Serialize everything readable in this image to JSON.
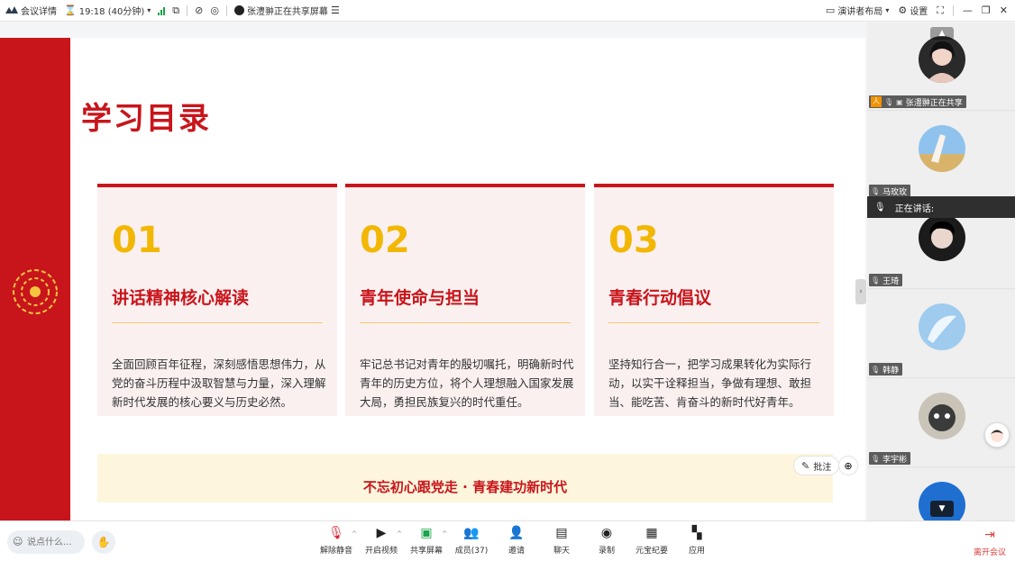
{
  "topbar": {
    "meeting_details": "会议详情",
    "time_text": "19:18 (40分钟)",
    "sharing_text": "张澧翀正在共享屏幕",
    "presenter_layout": "演讲者布局",
    "settings": "设置"
  },
  "slide": {
    "title": "学习目录",
    "cards": [
      {
        "num": "01",
        "heading": "讲话精神核心解读",
        "body": "全面回顾百年征程，深刻感悟思想伟力，从党的奋斗历程中汲取智慧与力量，深入理解新时代发展的核心要义与历史必然。"
      },
      {
        "num": "02",
        "heading": "青年使命与担当",
        "body": "牢记总书记对青年的殷切嘱托，明确新时代青年的历史方位，将个人理想融入国家发展大局，勇担民族复兴的时代重任。"
      },
      {
        "num": "03",
        "heading": "青春行动倡议",
        "body": "坚持知行合一，把学习成果转化为实际行动，以实干诠释担当，争做有理想、敢担当、能吃苦、肯奋斗的新时代好青年。"
      }
    ],
    "banner": "不忘初心跟党走 · 青春建功新时代",
    "annotate": "批注"
  },
  "participants": {
    "speaking_label": "正在讲话:",
    "list": [
      {
        "name": "张澧翀正在共享"
      },
      {
        "name": "马玫玫"
      },
      {
        "name": "王琦"
      },
      {
        "name": "韩静"
      },
      {
        "name": "李宇彬"
      }
    ]
  },
  "bottombar": {
    "say_placeholder": "说点什么...",
    "tools": [
      {
        "label": "解除静音",
        "icon": "mic-muted-icon"
      },
      {
        "label": "开启视频",
        "icon": "video-off-icon"
      },
      {
        "label": "共享屏幕",
        "icon": "share-screen-icon"
      },
      {
        "label": "成员(37)",
        "icon": "members-icon"
      },
      {
        "label": "邀请",
        "icon": "invite-icon"
      },
      {
        "label": "聊天",
        "icon": "chat-icon"
      },
      {
        "label": "录制",
        "icon": "record-icon"
      },
      {
        "label": "元宝纪要",
        "icon": "summary-icon"
      },
      {
        "label": "应用",
        "icon": "apps-icon"
      }
    ],
    "leave": "离开会议"
  },
  "colors": {
    "accent_red": "#c8151b",
    "number_gold": "#f2b705",
    "card_bg": "#fbf0f0",
    "banner_bg": "#fdf6dc",
    "signal_green": "#1aa34a"
  }
}
